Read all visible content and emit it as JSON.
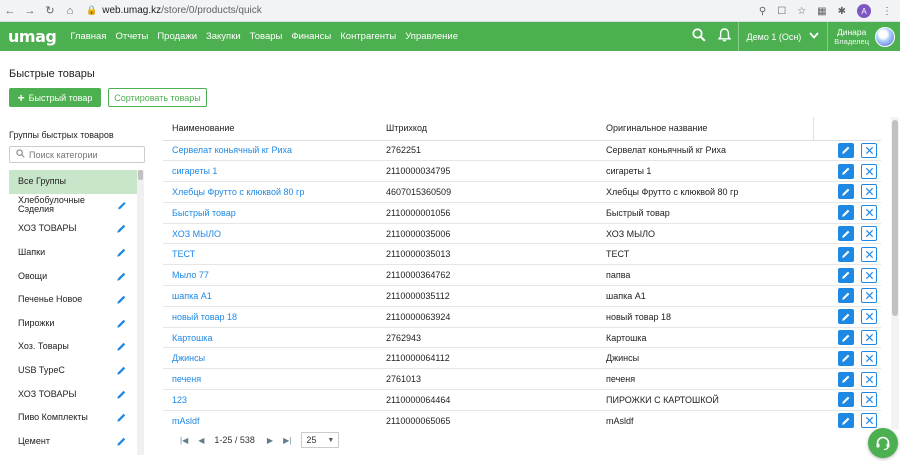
{
  "browser": {
    "url_host": "web.umag.kz",
    "url_path": "/store/0/products/quick"
  },
  "app": {
    "logo": "umag",
    "nav": [
      "Главная",
      "Отчеты",
      "Продажи",
      "Закупки",
      "Товары",
      "Финансы",
      "Контрагенты",
      "Управление"
    ],
    "store": "Демо 1 (Осн)",
    "user_name": "Динара",
    "user_role": "Владелец",
    "accent": "#4caf50",
    "link_color": "#1e88e5"
  },
  "page": {
    "title": "Быстрые товары",
    "add_button": "Быстрый товар",
    "sort_button": "Сортировать товары"
  },
  "groups": {
    "title": "Группы быстрых товаров",
    "search_placeholder": "Поиск категории",
    "items": [
      {
        "label": "Все Группы",
        "active": true
      },
      {
        "label": "Хлебобулочные Сэделия"
      },
      {
        "label": "ХОЗ ТОВАРЫ"
      },
      {
        "label": "Шапки"
      },
      {
        "label": "Овощи"
      },
      {
        "label": "Печенье Новое"
      },
      {
        "label": "Пирожки"
      },
      {
        "label": "Хоз. Товары"
      },
      {
        "label": "USB TypeC"
      },
      {
        "label": "ХОЗ ТОВАРЫ"
      },
      {
        "label": "Пиво Комплекты"
      },
      {
        "label": "Цемент"
      }
    ]
  },
  "table": {
    "columns": [
      "Наименование",
      "Штрихкод",
      "Оригинальное название"
    ],
    "rows": [
      {
        "name": "Сервелат коньячный кг Риха",
        "barcode": "2762251",
        "original": "Сервелат коньячный кг Риха"
      },
      {
        "name": "сигареты 1",
        "barcode": "2110000034795",
        "original": "сигареты 1"
      },
      {
        "name": "Хлебцы Фрутто с клюквой 80 гр",
        "barcode": "4607015360509",
        "original": "Хлебцы Фрутто с клюквой 80 гр"
      },
      {
        "name": "Быстрый товар",
        "barcode": "2110000001056",
        "original": "Быстрый товар"
      },
      {
        "name": "ХОЗ МЫЛО",
        "barcode": "2110000035006",
        "original": "ХОЗ МЫЛО"
      },
      {
        "name": "ТЕСТ",
        "barcode": "2110000035013",
        "original": "ТЕСТ"
      },
      {
        "name": "Мыло 77",
        "barcode": "2110000364762",
        "original": "папва"
      },
      {
        "name": "шапка А1",
        "barcode": "2110000035112",
        "original": "шапка А1"
      },
      {
        "name": "новый товар 18",
        "barcode": "2110000063924",
        "original": "новый товар 18"
      },
      {
        "name": "Картошка",
        "barcode": "2762943",
        "original": "Картошка"
      },
      {
        "name": "Джинсы",
        "barcode": "2110000064112",
        "original": "Джинсы"
      },
      {
        "name": "печеня",
        "barcode": "2761013",
        "original": "печеня"
      },
      {
        "name": "123",
        "barcode": "2110000064464",
        "original": "ПИРОЖКИ С КАРТОШКОЙ"
      },
      {
        "name": "mAsldf",
        "barcode": "2110000065065",
        "original": "mAsldf"
      }
    ]
  },
  "pagination": {
    "range": "1-25 / 538",
    "per_page": "25"
  }
}
